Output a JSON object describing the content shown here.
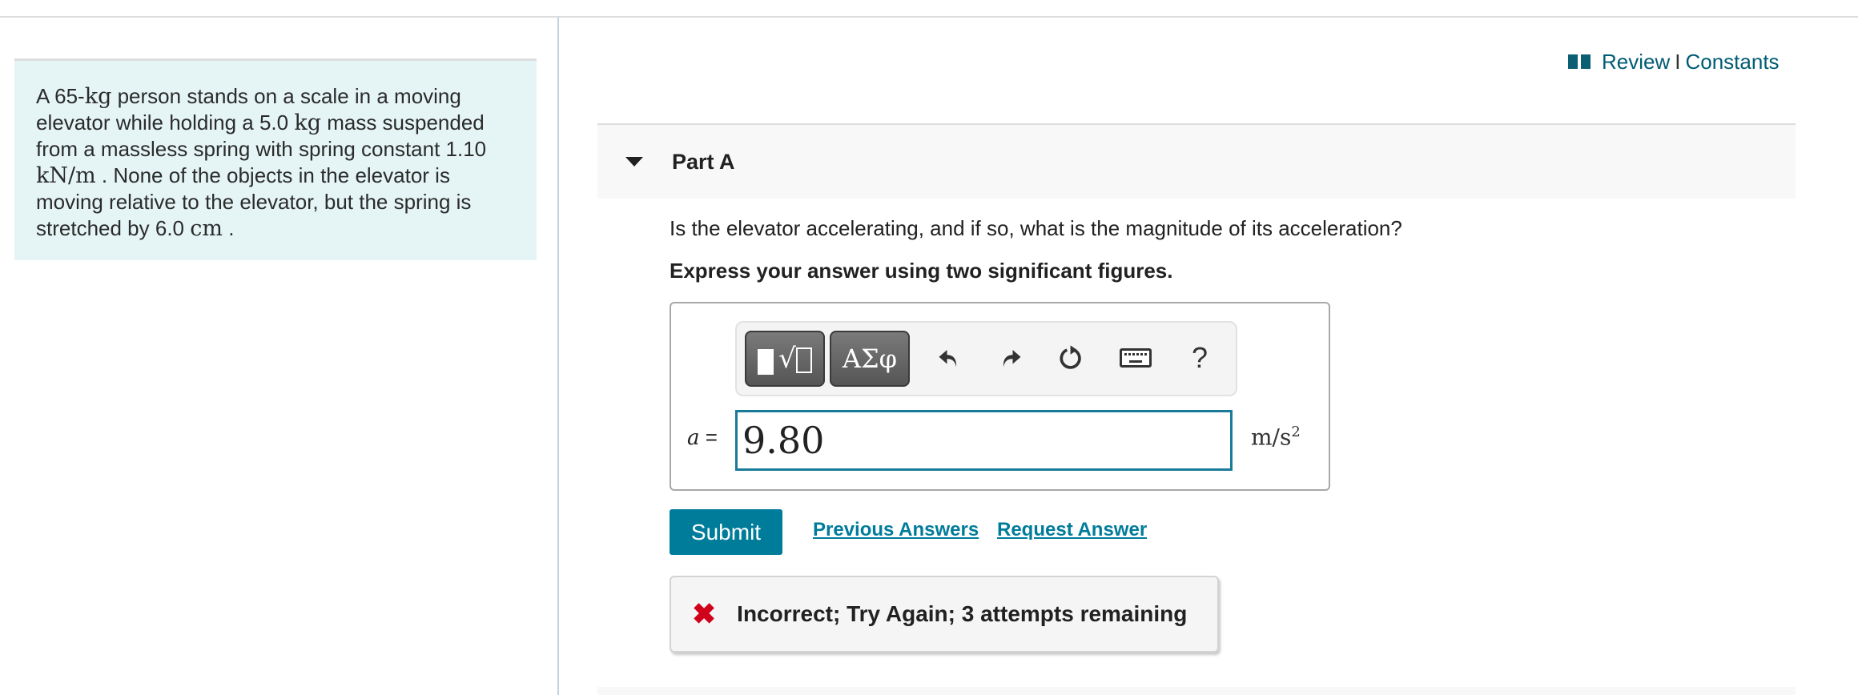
{
  "problem": {
    "segments": [
      {
        "t": "A 65-",
        "math": false
      },
      {
        "t": "kg",
        "math": true
      },
      {
        "t": " person stands on a scale in a moving elevator while holding a 5.0 ",
        "math": false
      },
      {
        "t": "kg",
        "math": true
      },
      {
        "t": " mass suspended from a massless spring with spring constant 1.10 ",
        "math": false
      },
      {
        "t": "kN/m",
        "math": true
      },
      {
        "t": " . None of the objects in the elevator is moving relative to the elevator, but the spring is stretched by 6.0 ",
        "math": false
      },
      {
        "t": "cm",
        "math": true
      },
      {
        "t": " .",
        "math": false
      }
    ]
  },
  "resources": {
    "icon": "book-icon",
    "review_label": "Review",
    "separator": "I",
    "constants_label": "Constants",
    "link_color": "#005c74"
  },
  "part": {
    "title": "Part A",
    "expanded": true,
    "question": "Is the elevator accelerating, and if so, what is the magnitude of its acceleration?",
    "instruction": "Express your answer using two significant figures."
  },
  "toolbar": {
    "templates_icon": "templates-sqrt-icon",
    "greek_label": "ΑΣφ",
    "undo_icon": "undo-icon",
    "redo_icon": "redo-icon",
    "reset_icon": "reset-icon",
    "keyboard_icon": "keyboard-icon",
    "help_label": "?"
  },
  "answer": {
    "variable": "a",
    "equals": "=",
    "value": "9.80",
    "unit_base": "m/s",
    "unit_exp": "2"
  },
  "actions": {
    "submit_label": "Submit",
    "previous_answers_label": "Previous Answers",
    "request_answer_label": "Request Answer",
    "accent_color": "#007c9b"
  },
  "feedback": {
    "icon": "x-icon",
    "text": "Incorrect; Try Again; 3 attempts remaining",
    "status_color": "#d0021b"
  }
}
